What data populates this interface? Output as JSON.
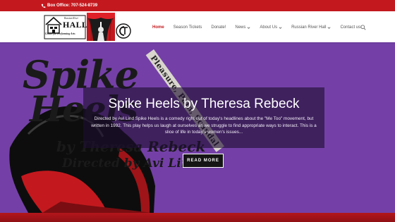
{
  "topbar": {
    "phone": "Box Office: 707-524-8739"
  },
  "logo": {
    "name_top": "Russian River",
    "name_main": "HALL",
    "tagline": "Center for Performing Arts"
  },
  "nav": {
    "items": [
      {
        "label": "Home",
        "active": true,
        "dropdown": false
      },
      {
        "label": "Season Tickets",
        "active": false,
        "dropdown": false
      },
      {
        "label": "Donate!",
        "active": false,
        "dropdown": false
      },
      {
        "label": "News",
        "active": false,
        "dropdown": true
      },
      {
        "label": "About Us",
        "active": false,
        "dropdown": true
      },
      {
        "label": "Russian River Hall",
        "active": false,
        "dropdown": true
      },
      {
        "label": "Contact us",
        "active": false,
        "dropdown": false
      }
    ]
  },
  "hero": {
    "poster": {
      "line1": "Spike",
      "line2": "Heels",
      "line3": "by Theresa Rebeck",
      "line4": "Directed by Avi Lind",
      "ribbon": "Pleasure, Pain, Scandal"
    },
    "title": "Spike Heels by Theresa Rebeck",
    "body": "Directed by Avi Lind Spike Heels is a comedy right out of today's headlines about the \"Me Too\" movement, but written in 1992. This play helps us laugh at ourselves as we struggle to find appropriate ways to interact. This is a slice of life in today's women's issues...",
    "button": "READ MORE"
  },
  "colors": {
    "brand_red": "#c3191e",
    "hero_purple": "#7440a7"
  }
}
